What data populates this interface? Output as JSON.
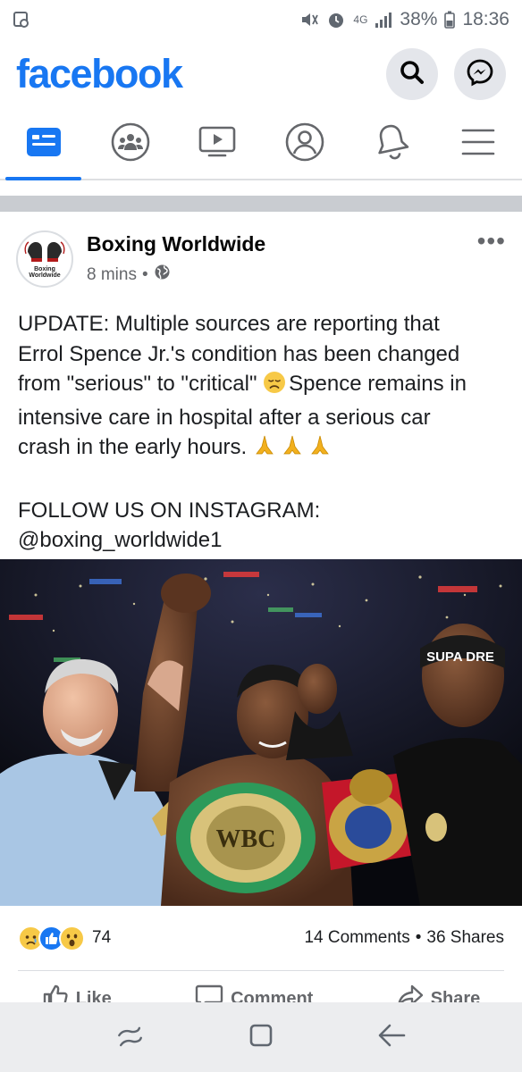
{
  "status_bar": {
    "network": "4G",
    "battery": "38%",
    "time": "18:36"
  },
  "header": {
    "logo": "facebook",
    "search_icon": "search-icon",
    "messenger_icon": "messenger-icon"
  },
  "tabs": [
    {
      "name": "home",
      "icon": "news-feed-icon",
      "active": true
    },
    {
      "name": "groups",
      "icon": "groups-icon"
    },
    {
      "name": "watch",
      "icon": "watch-icon"
    },
    {
      "name": "profile",
      "icon": "profile-icon"
    },
    {
      "name": "notifications",
      "icon": "bell-icon"
    },
    {
      "name": "menu",
      "icon": "hamburger-icon"
    }
  ],
  "post": {
    "page_name": "Boxing Worldwide",
    "time": "8 mins",
    "avatar_text_1": "Boxing",
    "avatar_text_2": "Worldwide",
    "text_line_1": "UPDATE: Multiple sources are reporting that",
    "text_line_2": "Errol Spence Jr.'s condition has been changed",
    "text_line_3a": "from \"serious\" to \"critical\" ",
    "text_line_3b": "Spence remains in",
    "text_line_4": "intensive care in hospital after a serious car",
    "text_line_5": "crash in the early hours. ",
    "text_line_6": "FOLLOW US ON INSTAGRAM:",
    "text_line_7": "@boxing_worldwide1",
    "photo_banner": "SUPA DRE",
    "photo_belt": "WBC"
  },
  "engagement": {
    "reaction_count": "74",
    "comments": "14 Comments",
    "shares": "36 Shares",
    "like_label": "Like",
    "comment_label": "Comment",
    "share_label": "Share"
  },
  "colors": {
    "brand": "#1877f2",
    "like_blue": "#1877f2",
    "emoji_yellow": "#f7c947"
  }
}
